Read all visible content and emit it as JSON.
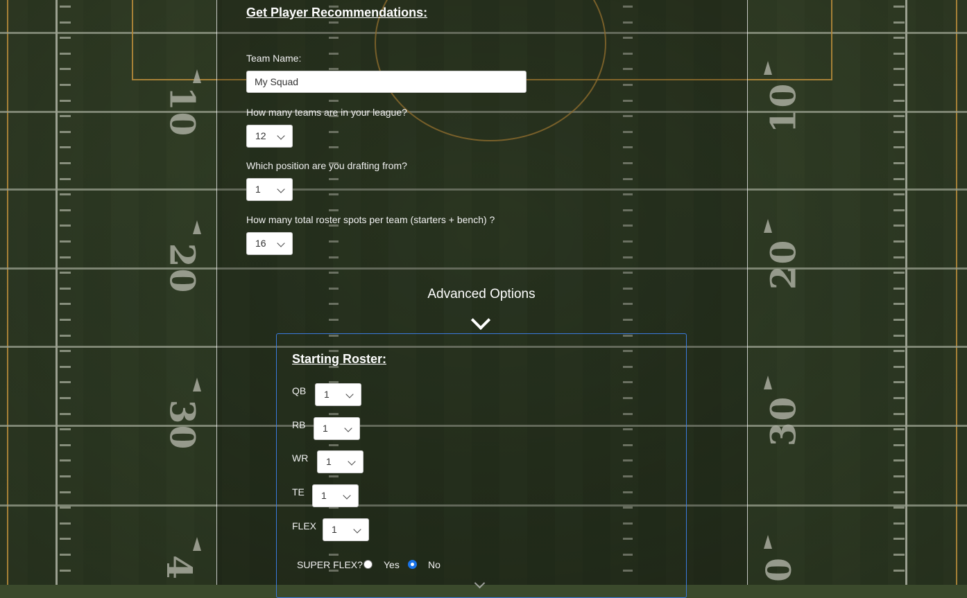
{
  "form": {
    "heading": "Get Player Recommendations:",
    "team_name_label": "Team Name:",
    "team_name_value": "My Squad",
    "teams_label": "How many teams are in your league?",
    "teams_value": "12",
    "position_label": "Which position are you drafting from?",
    "position_value": "1",
    "roster_spots_label": "How many total roster spots per team (starters + bench) ?",
    "roster_spots_value": "16"
  },
  "advanced": {
    "label": "Advanced Options",
    "toggle_icon": "chevron-down-icon"
  },
  "starting_roster": {
    "title": "Starting Roster:",
    "positions": [
      {
        "label": "QB",
        "value": "1"
      },
      {
        "label": "RB",
        "value": "1"
      },
      {
        "label": "WR",
        "value": "1"
      },
      {
        "label": "TE",
        "value": "1"
      },
      {
        "label": "FLEX",
        "value": "1"
      }
    ],
    "super_flex": {
      "label": "SUPER FLEX?",
      "yes_label": "Yes",
      "no_label": "No",
      "selected": "No"
    }
  },
  "background": {
    "yard_numbers": [
      "10",
      "20",
      "30",
      "4",
      "10",
      "20",
      "30",
      "0"
    ]
  }
}
